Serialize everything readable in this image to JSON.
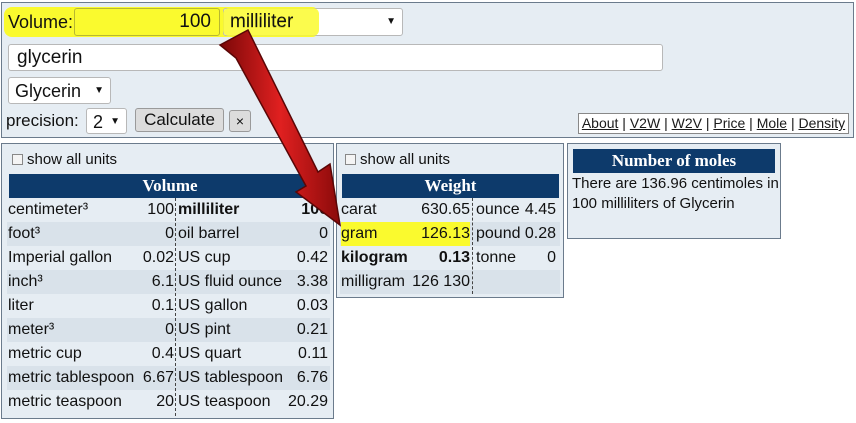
{
  "converter": {
    "volume_label": "Volume:",
    "volume_value": "100",
    "volume_unit": "milliliter",
    "substance_search": "glycerin",
    "substance_select": "Glycerin",
    "precision_label": "precision:",
    "precision_value": "2",
    "calculate_label": "Calculate",
    "clear_label": "×"
  },
  "links": [
    "About",
    "V2W",
    "W2V",
    "Price",
    "Mole",
    "Density"
  ],
  "volume_table": {
    "show_all": "show all units",
    "title": "Volume",
    "rows": [
      {
        "u1": "centimeter³",
        "v1": "100",
        "u2": "milliliter",
        "v2": "100",
        "bold": true
      },
      {
        "u1": "foot³",
        "v1": "0",
        "u2": "oil barrel",
        "v2": "0"
      },
      {
        "u1": "Imperial gallon",
        "v1": "0.02",
        "u2": "US cup",
        "v2": "0.42"
      },
      {
        "u1": "inch³",
        "v1": "6.1",
        "u2": "US fluid ounce",
        "v2": "3.38"
      },
      {
        "u1": "liter",
        "v1": "0.1",
        "u2": "US gallon",
        "v2": "0.03"
      },
      {
        "u1": "meter³",
        "v1": "0",
        "u2": "US pint",
        "v2": "0.21"
      },
      {
        "u1": "metric cup",
        "v1": "0.4",
        "u2": "US quart",
        "v2": "0.11"
      },
      {
        "u1": "metric tablespoon",
        "v1": "6.67",
        "u2": "US tablespoon",
        "v2": "6.76"
      },
      {
        "u1": "metric teaspoon",
        "v1": "20",
        "u2": "US teaspoon",
        "v2": "20.29"
      }
    ]
  },
  "weight_table": {
    "show_all": "show all units",
    "title": "Weight",
    "rows": [
      {
        "u1": "carat",
        "v1": "630.65",
        "u2": "ounce",
        "v2": "4.45"
      },
      {
        "u1": "gram",
        "v1": "126.13",
        "u2": "pound",
        "v2": "0.28"
      },
      {
        "u1": "kilogram",
        "v1": "0.13",
        "u2": "tonne",
        "v2": "0"
      },
      {
        "u1": "milligram",
        "v1": "126 130",
        "u2": "",
        "v2": ""
      }
    ]
  },
  "moles": {
    "title": "Number of moles",
    "text": "There are 136.96 centimoles in 100 milliliters of Glycerin"
  },
  "colors": {
    "highlight": "#fafa2e",
    "header": "#0d3a6b",
    "panel": "#e6edf3",
    "arrow": "#cc1111"
  }
}
